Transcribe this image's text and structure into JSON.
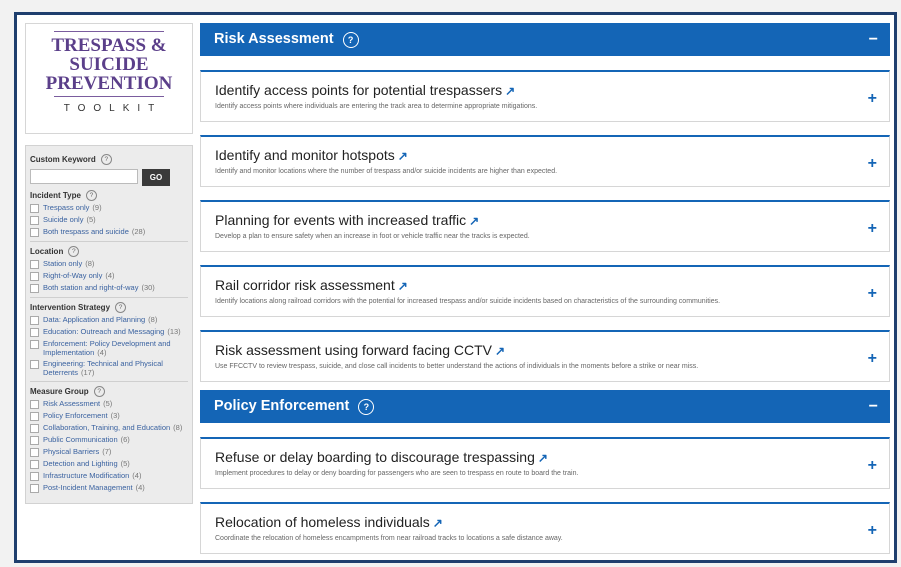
{
  "logo": {
    "title": "TRESPASS & SUICIDE PREVENTION",
    "subtitle": "TOOLKIT"
  },
  "filters": {
    "keyword_label": "Custom Keyword",
    "go_label": "GO",
    "sections": [
      {
        "title": "Incident Type",
        "items": [
          {
            "label": "Trespass only",
            "count": "(9)"
          },
          {
            "label": "Suicide only",
            "count": "(5)"
          },
          {
            "label": "Both trespass and suicide",
            "count": "(28)"
          }
        ]
      },
      {
        "title": "Location",
        "items": [
          {
            "label": "Station only",
            "count": "(8)"
          },
          {
            "label": "Right-of-Way only",
            "count": "(4)"
          },
          {
            "label": "Both station and right-of-way",
            "count": "(30)"
          }
        ]
      },
      {
        "title": "Intervention Strategy",
        "items": [
          {
            "label": "Data: Application and Planning",
            "count": "(8)"
          },
          {
            "label": "Education: Outreach and Messaging",
            "count": "(13)"
          },
          {
            "label": "Enforcement: Policy Development and Implementation",
            "count": "(4)"
          },
          {
            "label": "Engineering: Technical and Physical Deterrents",
            "count": "(17)"
          }
        ]
      },
      {
        "title": "Measure Group",
        "items": [
          {
            "label": "Risk Assessment",
            "count": "(5)"
          },
          {
            "label": "Policy Enforcement",
            "count": "(3)"
          },
          {
            "label": "Collaboration, Training, and Education",
            "count": "(8)"
          },
          {
            "label": "Public Communication",
            "count": "(6)"
          },
          {
            "label": "Physical Barriers",
            "count": "(7)"
          },
          {
            "label": "Detection and Lighting",
            "count": "(5)"
          },
          {
            "label": "Infrastructure Modification",
            "count": "(4)"
          },
          {
            "label": "Post-Incident Management",
            "count": "(4)"
          }
        ]
      }
    ]
  },
  "groups": [
    {
      "title": "Risk Assessment",
      "cards": [
        {
          "title": "Identify access points for potential trespassers",
          "desc": "Identify access points where individuals are entering the track area to determine appropriate mitigations."
        },
        {
          "title": "Identify and monitor hotspots",
          "desc": "Identify and monitor locations where the number of trespass and/or suicide incidents are higher than expected."
        },
        {
          "title": "Planning for events with increased traffic",
          "desc": "Develop a plan to ensure safety when an increase in foot or vehicle traffic near the tracks is expected."
        },
        {
          "title": "Rail corridor risk assessment",
          "desc": "Identify locations along railroad corridors with the potential for increased trespass and/or suicide incidents based on characteristics of the surrounding communities."
        },
        {
          "title": "Risk assessment using forward facing CCTV",
          "desc": "Use FFCCTV to review trespass, suicide, and close call incidents to better understand the actions of individuals in the moments before a strike or near miss."
        }
      ]
    },
    {
      "title": "Policy Enforcement",
      "cards": [
        {
          "title": "Refuse or delay boarding to discourage trespassing",
          "desc": "Implement procedures to delay or deny boarding for passengers who are seen to trespass en route to board the train."
        },
        {
          "title": "Relocation of homeless individuals",
          "desc": "Coordinate the relocation of homeless encampments from near railroad tracks to locations a safe distance away."
        }
      ]
    }
  ],
  "icons": {
    "help": "?",
    "arrow": "↗",
    "plus": "+",
    "minus": "−"
  }
}
